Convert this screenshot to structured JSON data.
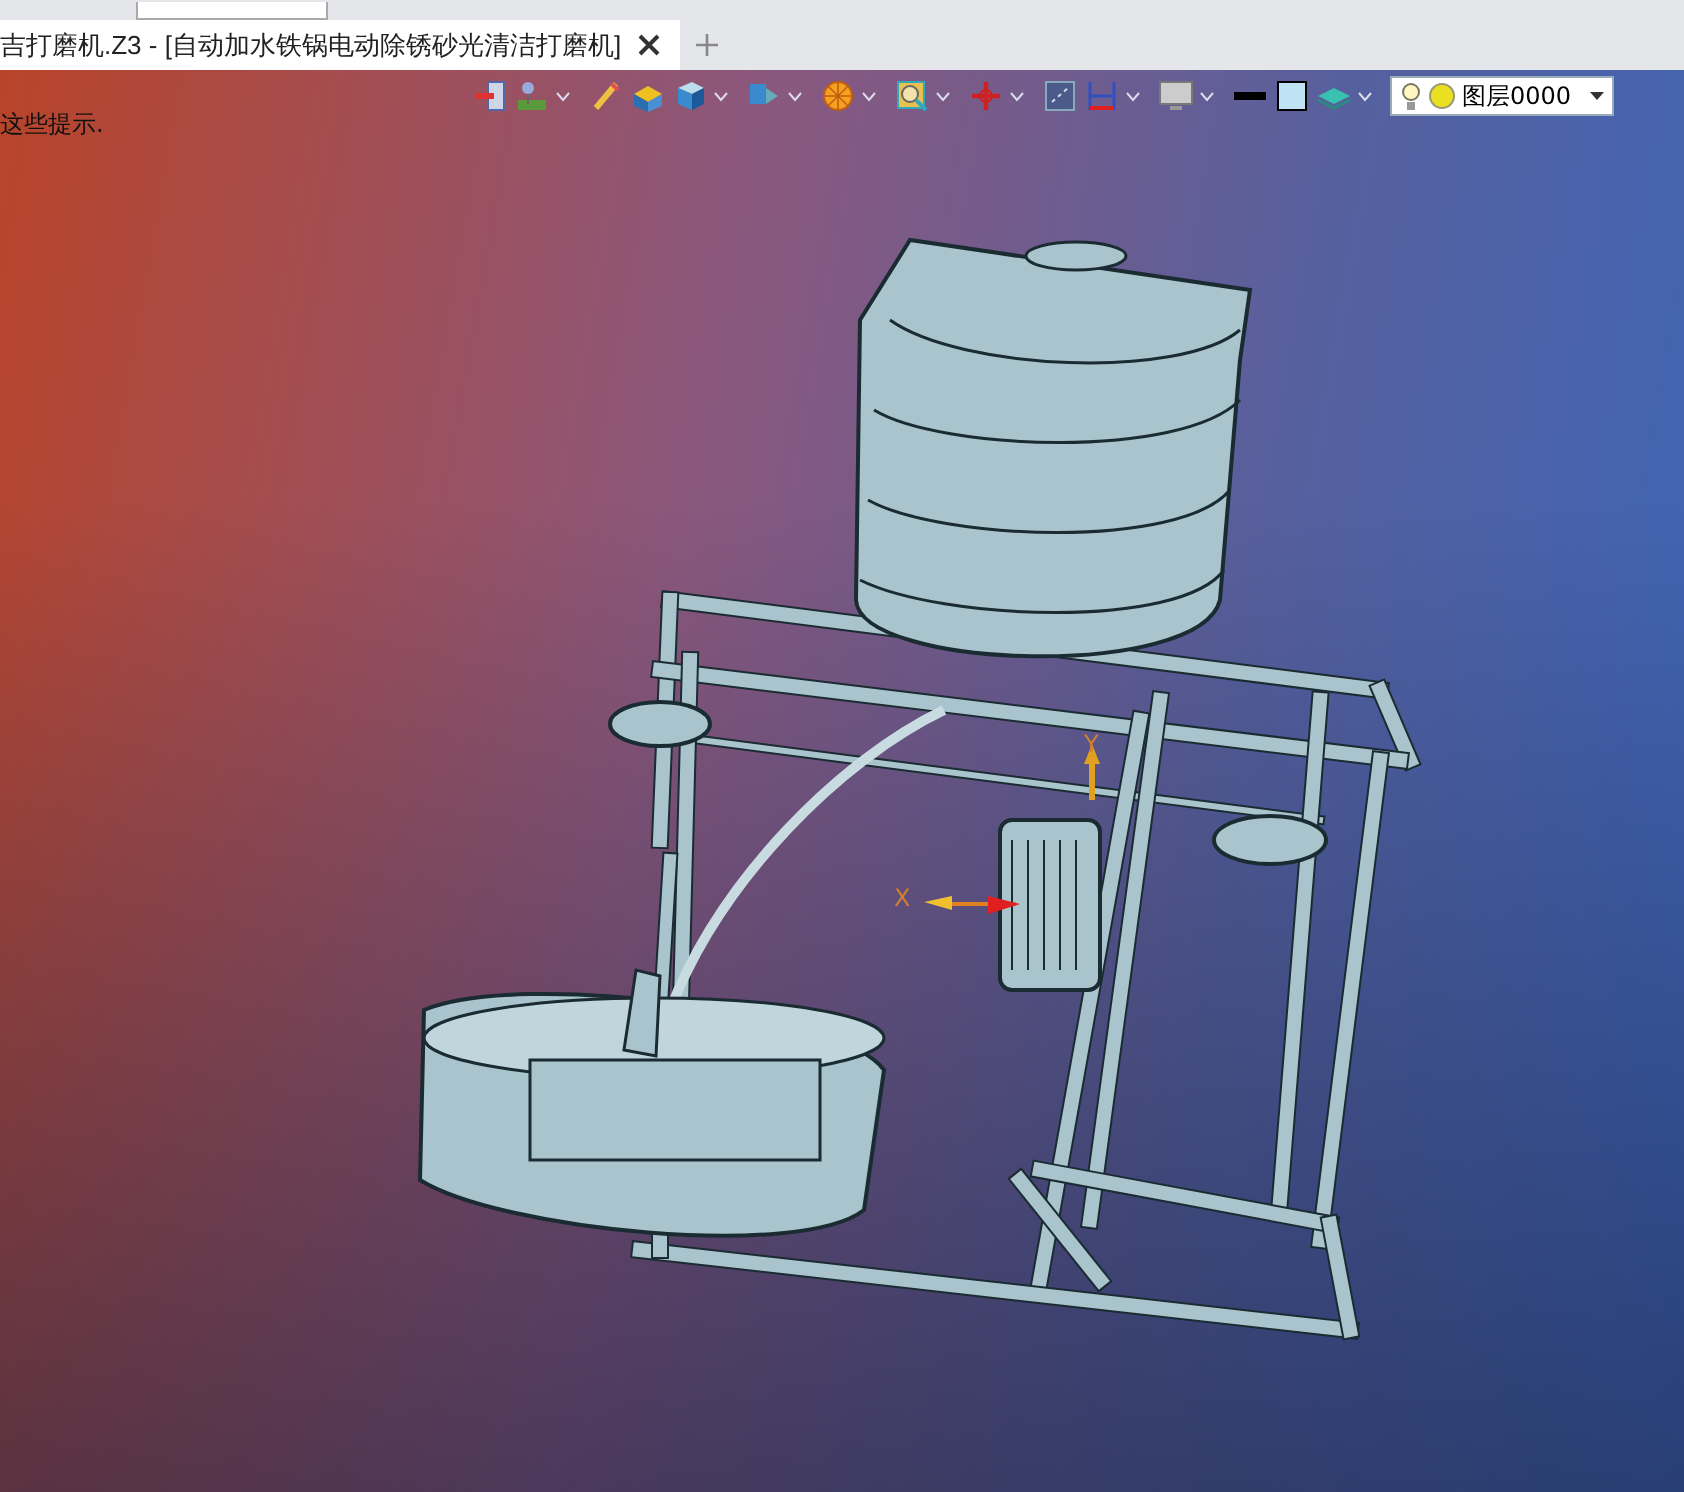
{
  "tabs": [
    {
      "label": "吉打磨机.Z3 - [自动加水铁锅电动除锈砂光清洁打磨机]",
      "selected": true
    }
  ],
  "hint": "这些提示.",
  "layer_selector": {
    "value": "图层0000"
  },
  "axes": {
    "x": "X",
    "y": "Y"
  }
}
